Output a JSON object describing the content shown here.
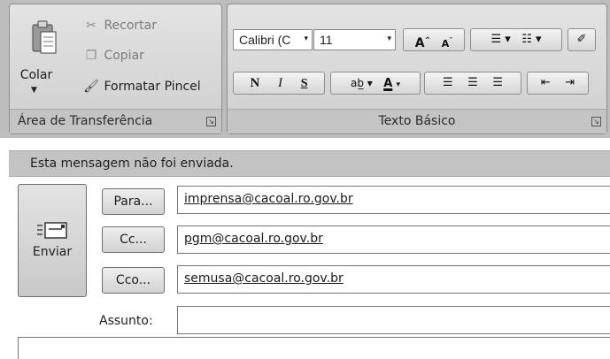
{
  "ribbon": {
    "clipboard": {
      "group_label": "Área de Transferência",
      "paste_label": "Colar",
      "cut_label": "Recortar",
      "copy_label": "Copiar",
      "format_painter_label": "Formatar Pincel"
    },
    "basic_text": {
      "group_label": "Texto Básico",
      "font_name": "Calibri (C",
      "font_size": "11",
      "bold_label": "N",
      "italic_label": "I",
      "underline_label": "S"
    }
  },
  "infobar": {
    "message": "Esta mensagem não foi enviada."
  },
  "header": {
    "send_label": "Enviar",
    "to_label": "Para...",
    "cc_label": "Cc...",
    "bcc_label": "Cco...",
    "to_value": "imprensa@cacoal.ro.gov.br",
    "cc_value": "pgm@cacoal.ro.gov.br",
    "bcc_value": "semusa@cacoal.ro.gov.br",
    "subject_label": "Assunto:",
    "subject_value": ""
  }
}
